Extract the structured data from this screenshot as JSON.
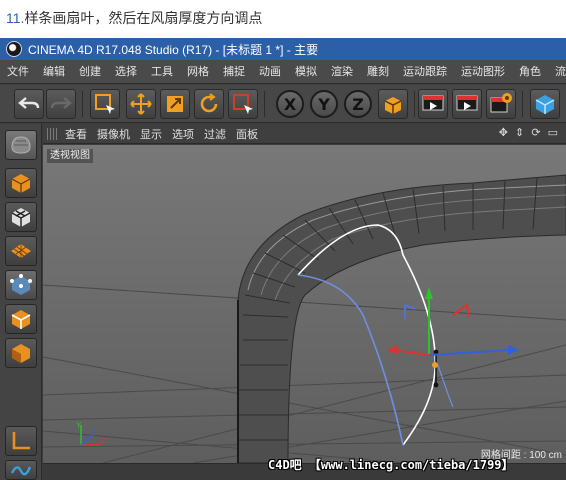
{
  "caption": {
    "number": "11.",
    "text": "样条画扇叶，然后在风扇厚度方向调点"
  },
  "window": {
    "title": "CINEMA 4D R17.048 Studio (R17) - [未标题 1 *] - 主要"
  },
  "menubar": {
    "items": [
      "文件",
      "编辑",
      "创建",
      "选择",
      "工具",
      "网格",
      "捕捉",
      "动画",
      "模拟",
      "渲染",
      "雕刻",
      "运动跟踪",
      "运动图形",
      "角色",
      "流水线"
    ]
  },
  "toolbar": {
    "axis_x": "X",
    "axis_y": "Y",
    "axis_z": "Z",
    "icons": [
      "undo-icon",
      "redo-icon",
      "live-selection-icon",
      "move-icon",
      "scale-icon",
      "rotate-icon",
      "recent-tools-icon",
      "coordinate-system-icon",
      "render-view-icon",
      "render-picture-viewer-icon",
      "render-settings-icon",
      "cube-icon"
    ]
  },
  "sidebar": {
    "icons": [
      "model-mode-icon",
      "make-editable-icon",
      "texture-mode-icon",
      "texture-axis-icon",
      "points-mode-icon",
      "edges-mode-icon",
      "polygons-mode-icon",
      "enable-axis-icon",
      "tweak-mode-icon",
      "snap-icon"
    ]
  },
  "viewport": {
    "menu": [
      "查看",
      "摄像机",
      "显示",
      "选项",
      "过滤",
      "面板"
    ],
    "label": "透视视图",
    "grid_info": "网格间距 : 100 cm",
    "axis_labels": {
      "y": "Y",
      "z": "Z",
      "x": "X"
    }
  },
  "colors": {
    "title_bar": "#2b5fa8",
    "accent_orange": "#f0a020",
    "spline_white": "#ffffff",
    "spline_blue": "#6f8fe0",
    "axis_red": "#e03030",
    "axis_green": "#30c030",
    "axis_blue": "#3060e0"
  },
  "watermark": "C4D吧 【www.linecg.com/tieba/1799】"
}
